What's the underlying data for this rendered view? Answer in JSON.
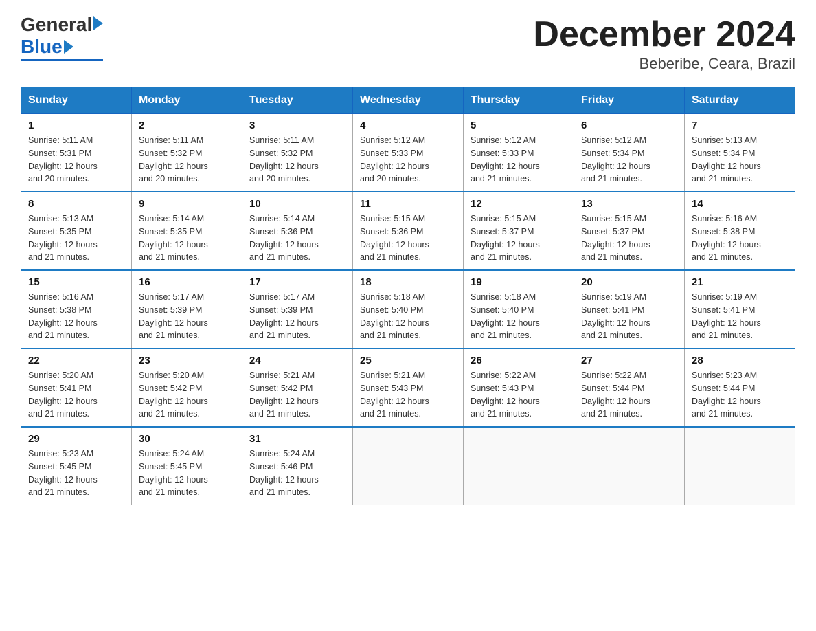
{
  "header": {
    "logo_general": "General",
    "logo_blue": "Blue",
    "title": "December 2024",
    "location": "Beberibe, Ceara, Brazil"
  },
  "days_of_week": [
    "Sunday",
    "Monday",
    "Tuesday",
    "Wednesday",
    "Thursday",
    "Friday",
    "Saturday"
  ],
  "weeks": [
    [
      {
        "num": "1",
        "sunrise": "5:11 AM",
        "sunset": "5:31 PM",
        "daylight": "12 hours and 20 minutes."
      },
      {
        "num": "2",
        "sunrise": "5:11 AM",
        "sunset": "5:32 PM",
        "daylight": "12 hours and 20 minutes."
      },
      {
        "num": "3",
        "sunrise": "5:11 AM",
        "sunset": "5:32 PM",
        "daylight": "12 hours and 20 minutes."
      },
      {
        "num": "4",
        "sunrise": "5:12 AM",
        "sunset": "5:33 PM",
        "daylight": "12 hours and 20 minutes."
      },
      {
        "num": "5",
        "sunrise": "5:12 AM",
        "sunset": "5:33 PM",
        "daylight": "12 hours and 21 minutes."
      },
      {
        "num": "6",
        "sunrise": "5:12 AM",
        "sunset": "5:34 PM",
        "daylight": "12 hours and 21 minutes."
      },
      {
        "num": "7",
        "sunrise": "5:13 AM",
        "sunset": "5:34 PM",
        "daylight": "12 hours and 21 minutes."
      }
    ],
    [
      {
        "num": "8",
        "sunrise": "5:13 AM",
        "sunset": "5:35 PM",
        "daylight": "12 hours and 21 minutes."
      },
      {
        "num": "9",
        "sunrise": "5:14 AM",
        "sunset": "5:35 PM",
        "daylight": "12 hours and 21 minutes."
      },
      {
        "num": "10",
        "sunrise": "5:14 AM",
        "sunset": "5:36 PM",
        "daylight": "12 hours and 21 minutes."
      },
      {
        "num": "11",
        "sunrise": "5:15 AM",
        "sunset": "5:36 PM",
        "daylight": "12 hours and 21 minutes."
      },
      {
        "num": "12",
        "sunrise": "5:15 AM",
        "sunset": "5:37 PM",
        "daylight": "12 hours and 21 minutes."
      },
      {
        "num": "13",
        "sunrise": "5:15 AM",
        "sunset": "5:37 PM",
        "daylight": "12 hours and 21 minutes."
      },
      {
        "num": "14",
        "sunrise": "5:16 AM",
        "sunset": "5:38 PM",
        "daylight": "12 hours and 21 minutes."
      }
    ],
    [
      {
        "num": "15",
        "sunrise": "5:16 AM",
        "sunset": "5:38 PM",
        "daylight": "12 hours and 21 minutes."
      },
      {
        "num": "16",
        "sunrise": "5:17 AM",
        "sunset": "5:39 PM",
        "daylight": "12 hours and 21 minutes."
      },
      {
        "num": "17",
        "sunrise": "5:17 AM",
        "sunset": "5:39 PM",
        "daylight": "12 hours and 21 minutes."
      },
      {
        "num": "18",
        "sunrise": "5:18 AM",
        "sunset": "5:40 PM",
        "daylight": "12 hours and 21 minutes."
      },
      {
        "num": "19",
        "sunrise": "5:18 AM",
        "sunset": "5:40 PM",
        "daylight": "12 hours and 21 minutes."
      },
      {
        "num": "20",
        "sunrise": "5:19 AM",
        "sunset": "5:41 PM",
        "daylight": "12 hours and 21 minutes."
      },
      {
        "num": "21",
        "sunrise": "5:19 AM",
        "sunset": "5:41 PM",
        "daylight": "12 hours and 21 minutes."
      }
    ],
    [
      {
        "num": "22",
        "sunrise": "5:20 AM",
        "sunset": "5:41 PM",
        "daylight": "12 hours and 21 minutes."
      },
      {
        "num": "23",
        "sunrise": "5:20 AM",
        "sunset": "5:42 PM",
        "daylight": "12 hours and 21 minutes."
      },
      {
        "num": "24",
        "sunrise": "5:21 AM",
        "sunset": "5:42 PM",
        "daylight": "12 hours and 21 minutes."
      },
      {
        "num": "25",
        "sunrise": "5:21 AM",
        "sunset": "5:43 PM",
        "daylight": "12 hours and 21 minutes."
      },
      {
        "num": "26",
        "sunrise": "5:22 AM",
        "sunset": "5:43 PM",
        "daylight": "12 hours and 21 minutes."
      },
      {
        "num": "27",
        "sunrise": "5:22 AM",
        "sunset": "5:44 PM",
        "daylight": "12 hours and 21 minutes."
      },
      {
        "num": "28",
        "sunrise": "5:23 AM",
        "sunset": "5:44 PM",
        "daylight": "12 hours and 21 minutes."
      }
    ],
    [
      {
        "num": "29",
        "sunrise": "5:23 AM",
        "sunset": "5:45 PM",
        "daylight": "12 hours and 21 minutes."
      },
      {
        "num": "30",
        "sunrise": "5:24 AM",
        "sunset": "5:45 PM",
        "daylight": "12 hours and 21 minutes."
      },
      {
        "num": "31",
        "sunrise": "5:24 AM",
        "sunset": "5:46 PM",
        "daylight": "12 hours and 21 minutes."
      },
      null,
      null,
      null,
      null
    ]
  ],
  "labels": {
    "sunrise": "Sunrise:",
    "sunset": "Sunset:",
    "daylight": "Daylight:"
  }
}
